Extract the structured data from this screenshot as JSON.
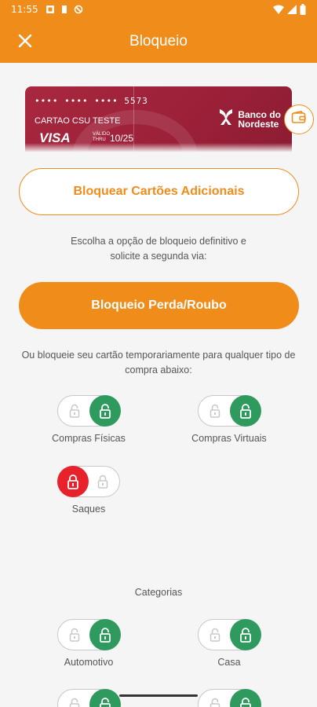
{
  "status_bar": {
    "time": "11:55",
    "icons": [
      "message-icon",
      "storage-icon",
      "blocked-icon",
      "wifi-icon",
      "signal-icon",
      "battery-icon"
    ]
  },
  "app_bar": {
    "title": "Bloqueio",
    "close_icon": "close-icon"
  },
  "card": {
    "number": "•••• •••• •••• 5573",
    "holder": "CARTAO CSU TESTE",
    "brand": "VISA",
    "valid_label_1": "VÁLIDO",
    "valid_label_2": "THRU",
    "expiry": "10/25",
    "bank_line1": "Banco do",
    "bank_line2": "Nordeste",
    "color": "#9a2038"
  },
  "actions": {
    "additional_cards_label": "Bloquear Cartões Adicionais",
    "definitive_text": "Escolha a opção de bloqueio definitivo e solicite a segunda via:",
    "loss_theft_label": "Bloqueio Perda/Roubo",
    "temporary_text": "Ou bloqueie seu cartão temporariamente para qualquer tipo de compra abaixo:"
  },
  "toggles": [
    {
      "label": "Compras Físicas",
      "state": "unlocked"
    },
    {
      "label": "Compras Virtuais",
      "state": "unlocked"
    },
    {
      "label": "Saques",
      "state": "locked"
    }
  ],
  "categories": {
    "title": "Categorias",
    "items": [
      {
        "label": "Automotivo",
        "state": "unlocked"
      },
      {
        "label": "Casa",
        "state": "unlocked"
      },
      {
        "label": "",
        "state": "unlocked"
      },
      {
        "label": "",
        "state": "unlocked"
      }
    ]
  },
  "colors": {
    "accent": "#f08c1a",
    "unlocked": "#2e9a5e",
    "locked": "#e8222a"
  }
}
